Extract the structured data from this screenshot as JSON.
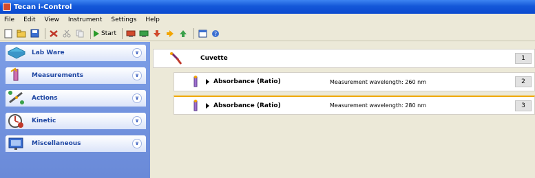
{
  "window": {
    "title": "Tecan i-Control"
  },
  "menu": {
    "items": [
      "File",
      "Edit",
      "View",
      "Instrument",
      "Settings",
      "Help"
    ]
  },
  "toolbar": {
    "start_label": "Start"
  },
  "sidebar": {
    "panels": [
      {
        "label": "Lab Ware",
        "icon": "plate-icon"
      },
      {
        "label": "Measurements",
        "icon": "measurement-icon"
      },
      {
        "label": "Actions",
        "icon": "actions-icon"
      },
      {
        "label": "Kinetic",
        "icon": "kinetic-icon"
      },
      {
        "label": "Miscellaneous",
        "icon": "miscellaneous-icon"
      }
    ]
  },
  "workflow": {
    "rows": [
      {
        "title": "Cuvette",
        "desc": "",
        "num": "1"
      },
      {
        "title": "Absorbance (Ratio)",
        "desc": "Measurement wavelength: 260 nm",
        "num": "2"
      },
      {
        "title": "Absorbance (Ratio)",
        "desc": "Measurement wavelength: 280 nm",
        "num": "3"
      }
    ]
  },
  "colors": {
    "titlebar": "#0a49cf",
    "sidebar": "#7d9ee6",
    "selection_accent": "#f0a800"
  }
}
